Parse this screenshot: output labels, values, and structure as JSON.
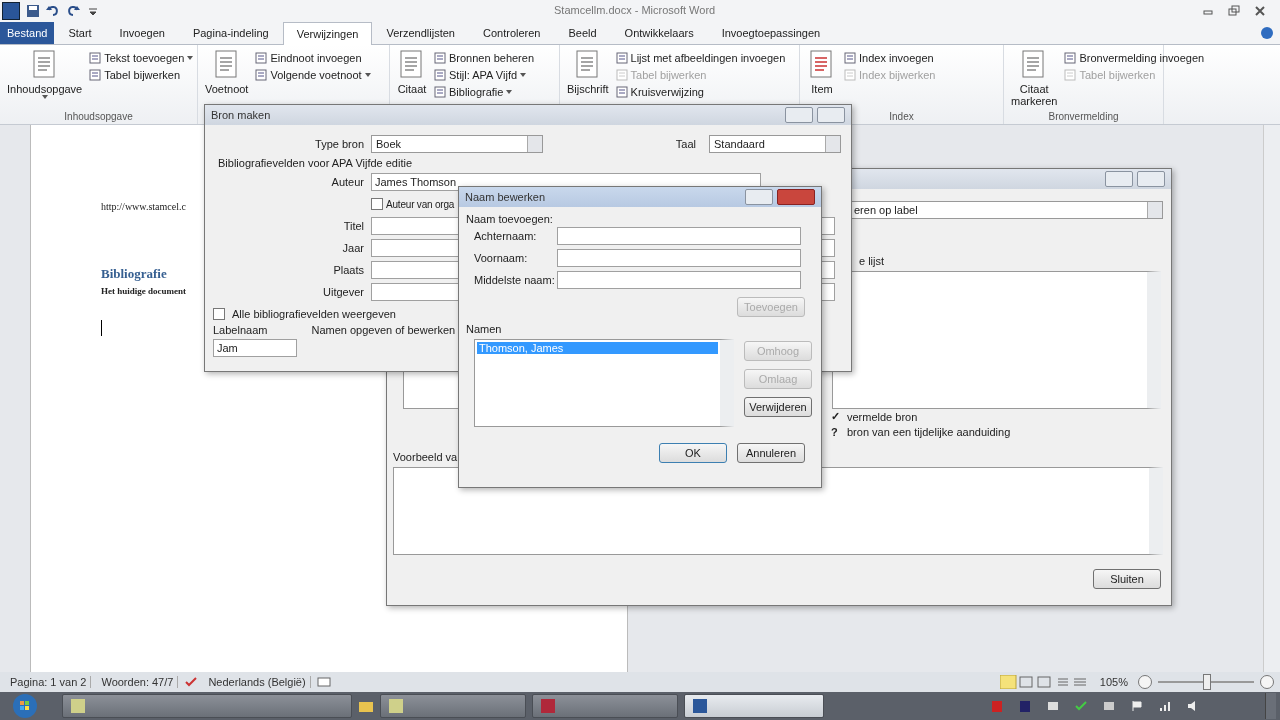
{
  "window": {
    "title": "Stamcellm.docx - Microsoft Word"
  },
  "tabs": [
    {
      "label": "Bestand",
      "kind": "file",
      "selected": false
    },
    {
      "label": "Start",
      "kind": "tab",
      "selected": false
    },
    {
      "label": "Invoegen",
      "kind": "tab",
      "selected": false
    },
    {
      "label": "Pagina-indeling",
      "kind": "tab",
      "selected": false
    },
    {
      "label": "Verwijzingen",
      "kind": "tab",
      "selected": true
    },
    {
      "label": "Verzendlijsten",
      "kind": "tab",
      "selected": false
    },
    {
      "label": "Controleren",
      "kind": "tab",
      "selected": false
    },
    {
      "label": "Beeld",
      "kind": "tab",
      "selected": false
    },
    {
      "label": "Ontwikkelaars",
      "kind": "tab",
      "selected": false
    },
    {
      "label": "Invoegtoepassingen",
      "kind": "tab",
      "selected": false
    }
  ],
  "ribbon": {
    "groups": [
      {
        "label": "Inhoudsopgave",
        "large": {
          "lines": [
            "Inhoudsopgave"
          ],
          "dropdown": true
        },
        "small": [
          {
            "label": "Tekst toevoegen",
            "dropdown": true,
            "disabled": false
          },
          {
            "label": "Tabel bijwerken",
            "dropdown": false,
            "disabled": false
          }
        ]
      },
      {
        "large": {
          "lines": [
            "Voetnoot"
          ],
          "dropdown": false
        },
        "small": [
          {
            "label": "Eindnoot invoegen",
            "dropdown": false,
            "disabled": false
          },
          {
            "label": "Volgende voetnoot",
            "dropdown": true,
            "disabled": false
          }
        ]
      },
      {
        "large": {
          "lines": [
            "Citaat"
          ],
          "dropdown": false
        },
        "small": [
          {
            "label": "Bronnen beheren",
            "dropdown": false,
            "disabled": false
          },
          {
            "label": "Stijl: APA Vijfd",
            "dropdown": true,
            "disabled": false
          },
          {
            "label": "Bibliografie",
            "dropdown": true,
            "disabled": false
          }
        ]
      },
      {
        "large": {
          "lines": [
            "Bijschrift"
          ],
          "dropdown": false
        },
        "small": [
          {
            "label": "Lijst met afbeeldingen invoegen",
            "dropdown": false,
            "disabled": false
          },
          {
            "label": "Tabel bijwerken",
            "dropdown": false,
            "disabled": true
          },
          {
            "label": "Kruisverwijzing",
            "dropdown": false,
            "disabled": false
          }
        ]
      },
      {
        "label": "Index",
        "large": {
          "lines": [
            "Item"
          ],
          "dropdown": false
        },
        "small": [
          {
            "label": "Index invoegen",
            "dropdown": false,
            "disabled": false
          },
          {
            "label": "Index bijwerken",
            "dropdown": false,
            "disabled": true
          }
        ]
      },
      {
        "label": "Bronvermelding",
        "large": {
          "lines": [
            "Citaat",
            "markeren"
          ],
          "dropdown": false
        },
        "small": [
          {
            "label": "Bronvermelding invoegen",
            "dropdown": false,
            "disabled": false
          },
          {
            "label": "Tabel bijwerken",
            "dropdown": false,
            "disabled": true
          }
        ]
      }
    ]
  },
  "document": {
    "link": "http://www.stamcel.c",
    "heading": "Bibliografie",
    "text": "Het huidige document"
  },
  "status_bar": {
    "page": "Pagina: 1 van 2",
    "words": "Woorden: 47/7",
    "language": "Nederlands (België)",
    "zoom": "105%",
    "zoom_level": {
      "level": 0.5
    }
  },
  "back_dialog": {
    "dropdown": "eren op label",
    "list_label": "e lijst",
    "legend": [
      {
        "mark": "✓",
        "text": "vermelde bron"
      },
      {
        "mark": "?",
        "text": "bron van een tijdelijke aanduiding"
      }
    ],
    "preview_label": "Voorbeeld va",
    "close_button": "Sluiten"
  },
  "source_dialog": {
    "title": "Bron maken",
    "type_label": "Type bron",
    "type_value": "Boek",
    "language_label": "Taal",
    "language_value": "Standaard",
    "fields_heading": "Bibliografievelden voor APA Vijfde editie",
    "author_label": "Auteur",
    "author_value": "James Thomson",
    "corporate": {
      "label": "Auteur van orga",
      "checked": false
    },
    "fields": [
      {
        "label": "Titel"
      },
      {
        "label": "Jaar"
      },
      {
        "label": "Plaats"
      },
      {
        "label": "Uitgever"
      }
    ],
    "show_all": {
      "label": "Alle bibliografievelden weergeven",
      "checked": false
    },
    "tag_label": "Labelnaam",
    "tag_value": "Jam",
    "hint": "Namen opgeven of bewerken"
  },
  "name_dialog": {
    "title": "Naam bewerken",
    "group_label": "Naam toevoegen:",
    "fields": [
      {
        "label": "Achternaam:"
      },
      {
        "label": "Voornaam:"
      },
      {
        "label": "Middelste naam:"
      }
    ],
    "add_button": {
      "label": "Toevoegen",
      "disabled": true
    },
    "names_label": "Namen",
    "names": [
      {
        "label": "Thomson, James",
        "selected": true
      }
    ],
    "side_buttons": [
      {
        "label": "Omhoog",
        "disabled": true
      },
      {
        "label": "Omlaag",
        "disabled": true
      },
      {
        "label": "Verwijderen",
        "disabled": false
      }
    ],
    "ok": "OK",
    "cancel": "Annuleren"
  }
}
